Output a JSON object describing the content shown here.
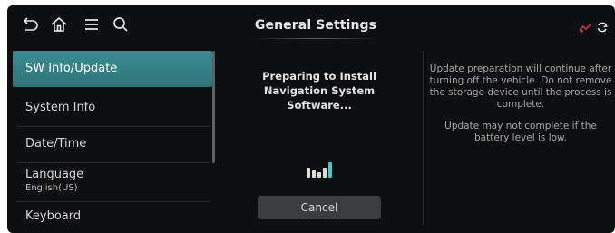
{
  "header": {
    "title": "General Settings",
    "icons": [
      "back-icon",
      "home-icon",
      "menu-icon",
      "search-icon"
    ],
    "status_icons": [
      "signal-status-icon",
      "sync-icon"
    ]
  },
  "sidebar": {
    "items": [
      {
        "label": "SW Info/Update",
        "active": true
      },
      {
        "label": "System Info",
        "active": false
      },
      {
        "label": "Date/Time",
        "active": false
      },
      {
        "label": "Language",
        "value": "English(US)",
        "active": false
      },
      {
        "label": "Keyboard",
        "active": false
      }
    ]
  },
  "main": {
    "status_text": "Preparing to Install Navigation System Software...",
    "cancel_label": "Cancel",
    "progress_icon": "loading-bars-icon"
  },
  "info": {
    "paragraphs": [
      "Update preparation will continue after turning off the vehicle. Do not remove the storage device until the process is complete.",
      "Update may not complete if the battery level is low."
    ]
  },
  "colors": {
    "background": "#0e0f10",
    "active_item": "#3a8d93",
    "accent_teal": "#46c8c8",
    "status_red": "#c23a3a"
  }
}
